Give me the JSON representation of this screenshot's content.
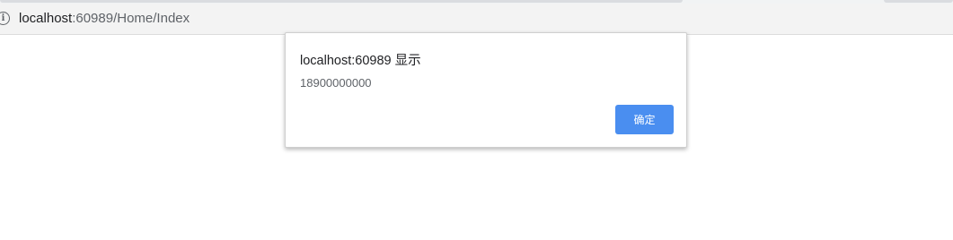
{
  "browser": {
    "address_bar": {
      "url_host": "localhost",
      "url_rest": ":60989/Home/Index",
      "site_info_icon": "info-circle-icon"
    }
  },
  "dialog": {
    "title": "localhost:60989 显示",
    "message": "18900000000",
    "ok_label": "确定"
  },
  "colors": {
    "ok_button": "#4a8ef0",
    "address_bar_bg": "#f3f3f3"
  }
}
